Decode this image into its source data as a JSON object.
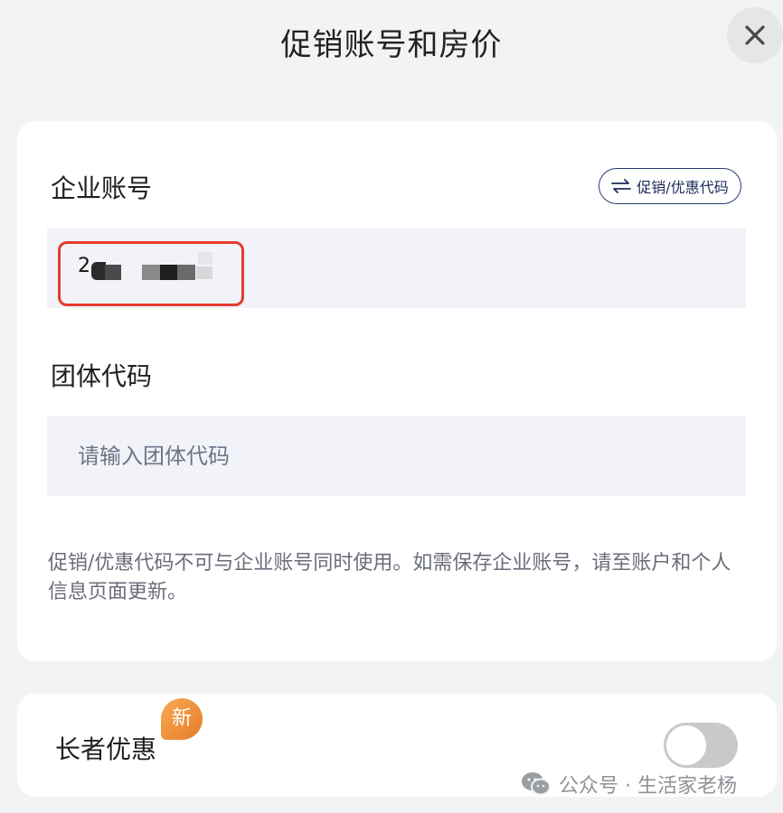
{
  "header": {
    "title": "促销账号和房价"
  },
  "corporate": {
    "label": "企业账号",
    "switch_label": "促销/优惠代码",
    "value_visible_prefix": "2"
  },
  "group": {
    "label": "团体代码",
    "placeholder": "请输入团体代码"
  },
  "notice": "促销/优惠代码不可与企业账号同时使用。如需保存企业账号，请至账户和个人信息页面更新。",
  "senior": {
    "label": "长者优惠",
    "badge": "新",
    "toggle_on": false
  },
  "watermark": {
    "text": "公众号 · 生活家老杨"
  },
  "colors": {
    "highlight_border": "#e53b2c",
    "badge_orange": "#e98a35",
    "chip_navy": "#2b3b70",
    "field_bg": "#f1f3f9"
  },
  "icons": [
    "close-icon",
    "swap-arrows-icon",
    "wechat-icon"
  ]
}
